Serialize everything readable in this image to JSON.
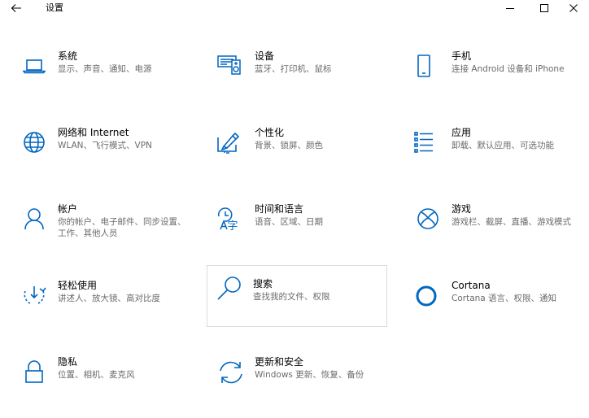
{
  "window": {
    "title": "设置",
    "accent_color": "#0067c0"
  },
  "tiles": [
    {
      "name": "系统",
      "desc": "显示、声音、通知、电源",
      "icon": "laptop-icon"
    },
    {
      "name": "设备",
      "desc": "蓝牙、打印机、鼠标",
      "icon": "devices-icon"
    },
    {
      "name": "手机",
      "desc": "连接 Android 设备和 iPhone",
      "icon": "phone-icon"
    },
    {
      "name": "网络和 Internet",
      "desc": "WLAN、飞行模式、VPN",
      "icon": "globe-icon"
    },
    {
      "name": "个性化",
      "desc": "背景、锁屏、颜色",
      "icon": "personalization-icon"
    },
    {
      "name": "应用",
      "desc": "卸载、默认应用、可选功能",
      "icon": "apps-list-icon"
    },
    {
      "name": "帐户",
      "desc": "你的帐户、电子邮件、同步设置、工作、其他人员",
      "icon": "person-icon"
    },
    {
      "name": "时间和语言",
      "desc": "语音、区域、日期",
      "icon": "time-language-icon"
    },
    {
      "name": "游戏",
      "desc": "游戏栏、截屏、直播、游戏模式",
      "icon": "xbox-icon"
    },
    {
      "name": "轻松使用",
      "desc": "讲述人、放大镜、高对比度",
      "icon": "ease-of-access-icon"
    },
    {
      "name": "搜索",
      "desc": "查找我的文件、权限",
      "icon": "search-icon"
    },
    {
      "name": "Cortana",
      "desc": "Cortana 语言、权限、通知",
      "icon": "cortana-icon"
    },
    {
      "name": "隐私",
      "desc": "位置、相机、麦克风",
      "icon": "lock-icon"
    },
    {
      "name": "更新和安全",
      "desc": "Windows 更新、恢复、备份",
      "icon": "sync-icon"
    }
  ]
}
